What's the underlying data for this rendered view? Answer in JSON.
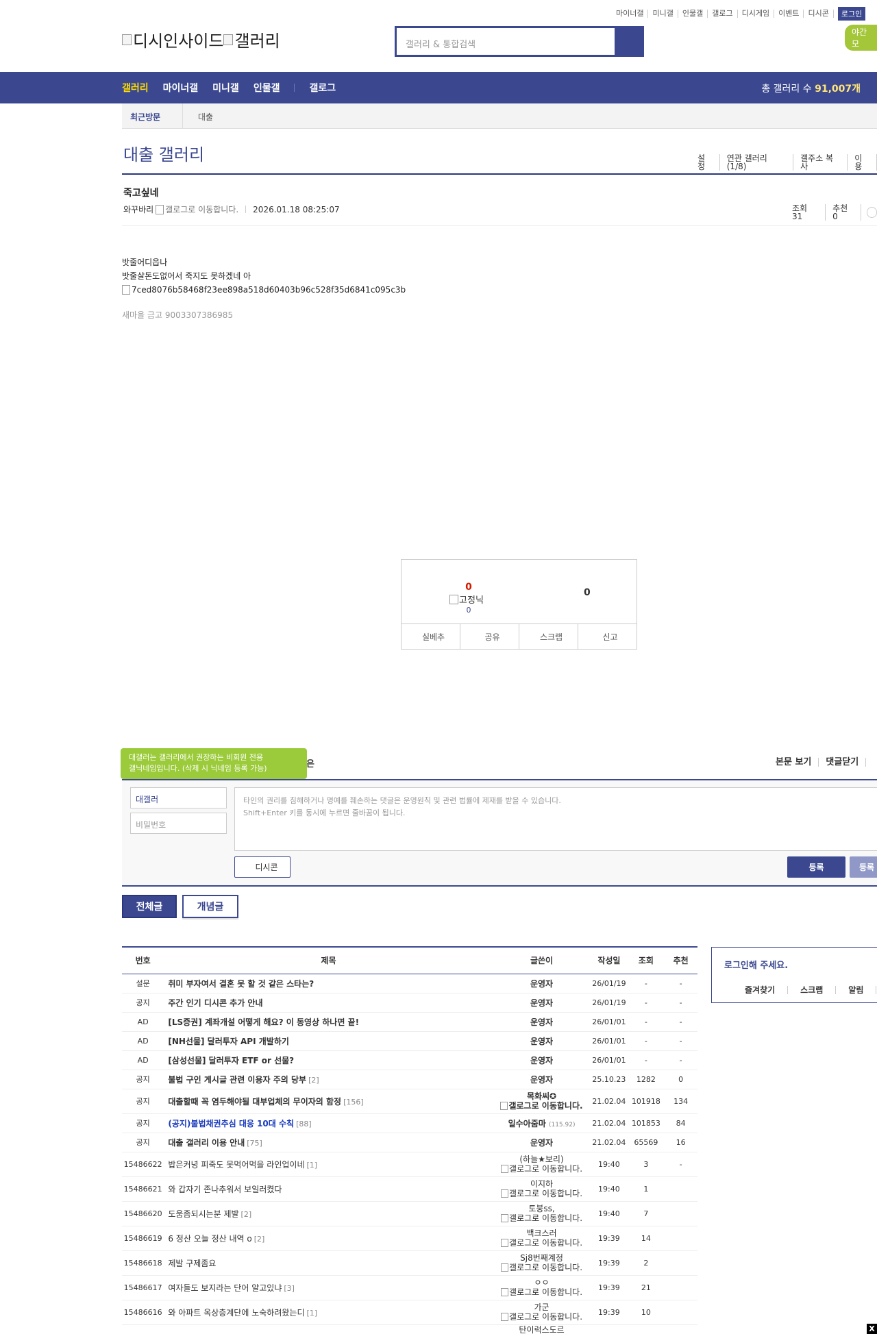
{
  "top_nav": [
    "마이너갤",
    "미니갤",
    "인물갤",
    "갤로그",
    "디시게임",
    "이벤트",
    "디시콘"
  ],
  "login_label": "로그인",
  "night_label": "야간 모",
  "logo_text": "디시인사이드",
  "logo_gallery": "갤러리",
  "search_placeholder": "갤러리 & 통합검색",
  "gnb": {
    "items": [
      "갤러리",
      "마이너갤",
      "미니갤",
      "인물갤",
      "갤로그"
    ],
    "total_label": "총 갤러리 수",
    "total_value": "91,007개"
  },
  "recent_visit": {
    "label": "최근방문",
    "item": "대출"
  },
  "gallery": {
    "title": "대출 갤러리",
    "links": [
      "설정",
      "연관 갤러리(1/8)",
      "갤주소 복사",
      "이용"
    ]
  },
  "post": {
    "title": "죽고싶네",
    "author": "와꾸바리",
    "gallog_alt": "갤로그로 이동합니다.",
    "date": "2026.01.18 08:25:07",
    "views_label": "조회 31",
    "recommend_label": "추천 0",
    "body_lines": [
      "밧줄어디읍나",
      "밧줄살돈도없어서 죽지도 못하겠네 아"
    ],
    "image_alt": "7ced8076b58468f23ee898a518d60403b96c528f35d6841c095c3b",
    "ad_text": "새마을 금고 9003307386985"
  },
  "recommend": {
    "up_count": "0",
    "fixed_label": "고정닉",
    "fixed_count": "0",
    "down_count": "0",
    "buttons": [
      "실베추",
      "공유",
      "스크랩",
      "신고"
    ]
  },
  "comment": {
    "tooltip_line1": "대갤러는 갤러리에서 권장하는 비회원 전용",
    "tooltip_line2": "갤닉네임입니다. (삭제 시 닉네임 등록 가능)",
    "tooltip_tail": "은",
    "links": [
      "본문 보기",
      "댓글닫기"
    ],
    "name_value": "대갤러",
    "pw_placeholder": "비밀번호",
    "ta_line1": "타인의 권리를 침해하거나 명예를 훼손하는 댓글은 운영원칙 및 관련 법률에 제재를 받을 수 있습니다.",
    "ta_line2": "Shift+Enter 키를 동시에 누르면 줄바꿈이 됩니다.",
    "dccon": "디시콘",
    "submit": "등록",
    "submit2": "등록"
  },
  "tabs": {
    "all": "전체글",
    "best": "개념글"
  },
  "table": {
    "headers": [
      "번호",
      "제목",
      "글쓴이",
      "작성일",
      "조회",
      "추천"
    ]
  },
  "rows": [
    {
      "num": "설문",
      "title": "취미 부자여서 결혼 못 할 것 같은 스타는?",
      "reply": "",
      "writer": "운영자",
      "date": "26/01/19",
      "views": "-",
      "rec": "-"
    },
    {
      "num": "공지",
      "title": "주간 인기 디시콘 추가 안내",
      "reply": "",
      "writer": "운영자",
      "date": "26/01/19",
      "views": "-",
      "rec": "-"
    },
    {
      "num": "AD",
      "title": "[LS증권] 계좌개설 어떻게 해요? 이 동영상 하나면 끝!",
      "reply": "",
      "writer": "운영자",
      "date": "26/01/01",
      "views": "-",
      "rec": "-"
    },
    {
      "num": "AD",
      "title": "[NH선물] 달러투자 API 개발하기",
      "reply": "",
      "writer": "운영자",
      "date": "26/01/01",
      "views": "-",
      "rec": "-"
    },
    {
      "num": "AD",
      "title": "[삼성선물] 달러투자 ETF or 선물?",
      "reply": "",
      "writer": "운영자",
      "date": "26/01/01",
      "views": "-",
      "rec": "-"
    },
    {
      "num": "공지",
      "title": "불법 구인 게시글 관련 이용자 주의 당부",
      "reply": "[2]",
      "writer": "운영자",
      "date": "25.10.23",
      "views": "1282",
      "rec": "0"
    },
    {
      "num": "공지",
      "title": "대출할때 꼭 염두해야될 대부업체의 무이자의 함정",
      "reply": "[156]",
      "writer": "목화씨✪",
      "writer2": "갤로그로 이동합니다.",
      "date": "21.02.04",
      "views": "101918",
      "rec": "134"
    },
    {
      "num": "공지",
      "title": "(공지)불법채권추심 대응 10대 수칙",
      "reply": "[88]",
      "writer": "일수아줌마",
      "ip": "(115.92)",
      "date": "21.02.04",
      "views": "101853",
      "rec": "84"
    },
    {
      "num": "공지",
      "title": "대출 갤러리 이용 안내",
      "reply": "[75]",
      "writer": "운영자",
      "date": "21.02.04",
      "views": "65569",
      "rec": "16"
    },
    {
      "num": "15486622",
      "title": "밥은커녕 피죽도 못먹어먹을 라인업이네",
      "reply": "[1]",
      "writer": "(하늘★보리)",
      "writer2": "갤로그로 이동합니다.",
      "date": "19:40",
      "views": "3",
      "rec": "-"
    },
    {
      "num": "15486621",
      "title": "와 갑자기 존나추워서 보일러켰다",
      "reply": "",
      "writer": "이지하",
      "writer2": "갤로그로 이동합니다.",
      "date": "19:40",
      "views": "1",
      "rec": ""
    },
    {
      "num": "15486620",
      "title": "도움좀되시는분 제발",
      "reply": "[2]",
      "writer": "토붕ss,",
      "writer2": "갤로그로 이동합니다.",
      "date": "19:40",
      "views": "7",
      "rec": ""
    },
    {
      "num": "15486619",
      "title": "6 정산 오늘 정산 내역 o",
      "reply": "[2]",
      "writer": "백크스러",
      "writer2": "갤로그로 이동합니다.",
      "date": "19:39",
      "views": "14",
      "rec": ""
    },
    {
      "num": "15486618",
      "title": "제발 구제좀요",
      "reply": "",
      "writer": "Sj8번째계정",
      "writer2": "갤로그로 이동합니다.",
      "date": "19:39",
      "views": "2",
      "rec": ""
    },
    {
      "num": "15486617",
      "title": "여자들도 보지라는 단어 알고있냐",
      "reply": "[3]",
      "writer": "ㅇㅇ",
      "writer2": "갤로그로 이동합니다.",
      "date": "19:39",
      "views": "21",
      "rec": ""
    },
    {
      "num": "15486616",
      "title": "와 아파트 옥상층계단에 노숙하려왔는디",
      "reply": "[1]",
      "writer": "가군",
      "writer2": "갤로그로 이동합니다.",
      "date": "19:39",
      "views": "10",
      "rec": ""
    },
    {
      "num": "",
      "title": "",
      "reply": "",
      "writer": "탄이럭스도르",
      "date": "",
      "views": "",
      "rec": ""
    }
  ],
  "login_box": {
    "msg": "로그인해 주세요.",
    "links": [
      "즐겨찾기",
      "스크랩",
      "알림"
    ]
  },
  "close_label": "X"
}
